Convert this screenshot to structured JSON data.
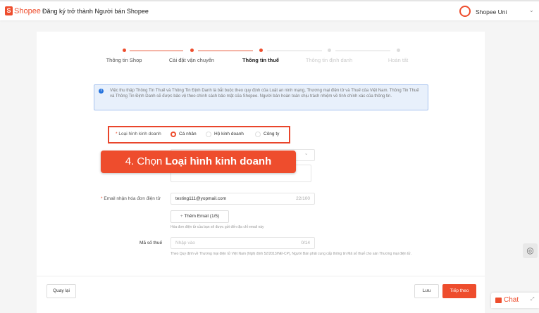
{
  "header": {
    "logo": "Shopee",
    "title": "Đăng ký trở thành Người bán Shopee",
    "user": "Shopee Uni"
  },
  "steps": [
    {
      "label": "Thông tin Shop",
      "state": "done"
    },
    {
      "label": "Cài đặt vận chuyển",
      "state": "done"
    },
    {
      "label": "Thông tin thuế",
      "state": "current"
    },
    {
      "label": "Thông tin định danh",
      "state": "todo"
    },
    {
      "label": "Hoàn tất",
      "state": "todo"
    }
  ],
  "info": "Việc thu thập Thông Tin Thuế và Thông Tin Định Danh là bắt buộc theo quy định của Luật an ninh mạng, Thương mại điện tử và Thuế của Việt Nam. Thông Tin Thuế và Thông Tin Định Danh sẽ được bảo vệ theo chính sách bảo mật của Shopee. Người bán hoàn toàn chịu trách nhiệm về tính chính xác của thông tin.",
  "business_type": {
    "label": "Loại hình kinh doanh",
    "options": [
      "Cá nhân",
      "Hộ kinh doanh",
      "Công ty"
    ],
    "selected": "Cá nhân"
  },
  "banner": {
    "prefix": "4. Chọn ",
    "bold": "Loại hình kinh doanh"
  },
  "email": {
    "label": "Email nhận hóa đơn điện tử",
    "value": "testing111@yopmail.com",
    "count": "22/100",
    "add_button": "Thêm Email (1/5)",
    "help": "Hóa đơn điện tử của bạn sẽ được gửi đến địa chỉ email này"
  },
  "tax": {
    "label": "Mã số thuế",
    "placeholder": "Nhập vào",
    "count": "0/14",
    "help": "Theo Quy định về Thương mại điện tử Việt Nam (Nghị định 52/2013/NĐ-CP), Người Bán phải cung cấp thông tin Mã số thuế cho sàn Thương mại điện tử."
  },
  "footer": {
    "back": "Quay lại",
    "save": "Lưu",
    "next": "Tiếp theo"
  },
  "chat": {
    "label": "Chat"
  },
  "colors": {
    "accent": "#ee4d2d",
    "info_bg": "#e8f0fb"
  }
}
